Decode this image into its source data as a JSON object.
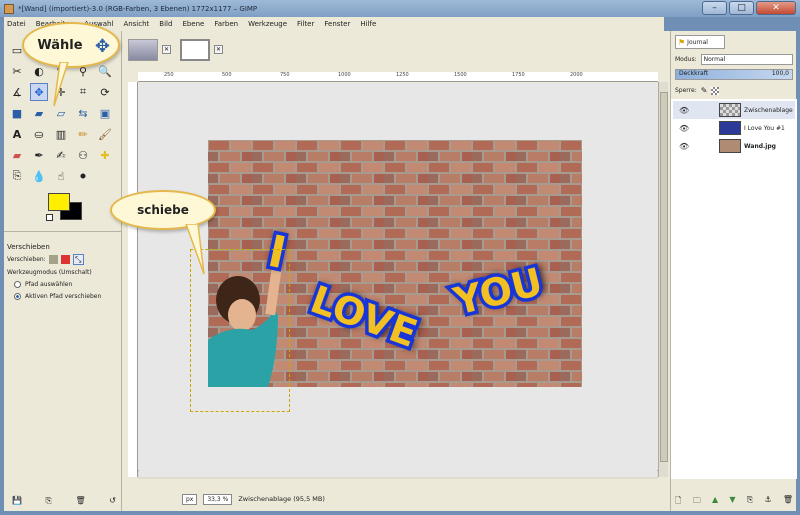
{
  "window": {
    "title": "*[Wand] (importiert)-3.0 (RGB-Farben, 3 Ebenen) 1772x1177 – GIMP"
  },
  "menu": [
    "Datei",
    "Bearbeiten",
    "Auswahl",
    "Ansicht",
    "Bild",
    "Ebene",
    "Farben",
    "Werkzeuge",
    "Filter",
    "Fenster",
    "Hilfe"
  ],
  "tool_options": {
    "title": "Verschieben",
    "move_label": "Verschieben:",
    "mode_label": "Werkzeugmodus (Umschalt)",
    "opt1": "Pfad auswählen",
    "opt2": "Aktiven Pfad verschieben"
  },
  "callouts": {
    "top": "Wähle",
    "mid": "schiebe"
  },
  "graffiti": {
    "line1": "I Love You"
  },
  "status": {
    "unit": "px",
    "zoom": "33,3 %",
    "message": "Zwischenablage (95,5 MB)"
  },
  "dock": {
    "tab_label": "Journal",
    "mode_label": "Modus:",
    "mode_value": "Normal",
    "opacity_label": "Deckkraft",
    "opacity_value": "100,0",
    "lock_label": "Sperre:",
    "layers": [
      {
        "name": "Zwischenablage"
      },
      {
        "name": "I Love You #1"
      },
      {
        "name": "Wand.jpg"
      }
    ]
  },
  "ruler_ticks": [
    "250",
    "500",
    "750",
    "1000",
    "1250",
    "1500",
    "1750",
    "2000"
  ],
  "colors": {
    "fg": "#ffee00",
    "bg": "#000000",
    "accent": "#1f5fd0"
  }
}
